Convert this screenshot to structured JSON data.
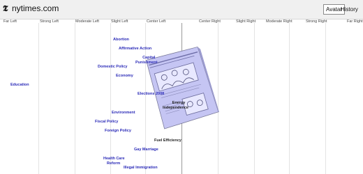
{
  "header": {
    "site_name": "nytimes.com",
    "logo_icon": "nyt-t-logo-icon",
    "avatar_button": "Avatar",
    "history_link": "History"
  },
  "spectrum": {
    "columns": [
      "Far Left",
      "Strong Left",
      "Moderate Left",
      "Slight Left",
      "Center Left",
      "Center Right",
      "Slight Right",
      "Moderate Right",
      "Strong Right",
      "Far Right"
    ]
  },
  "topics": {
    "abortion": "Abortion",
    "affirmative_action": "Affirmative Action",
    "capital_punishment_1": "Capital",
    "capital_punishment_2": "Punishment",
    "domestic_policy": "Domestic Policy",
    "economy": "Economy",
    "education": "Education",
    "elections_2008": "Elections 2008",
    "energy_independence_1": "Energy",
    "energy_independence_2": "Independence",
    "environment": "Environment",
    "fiscal_policy": "Fiscal Policy",
    "foreign_policy": "Foreign Policy",
    "fuel_efficiency": "Fuel Efficiency",
    "gay_marriage": "Gay Marriage",
    "health_care_1": "Health Care",
    "health_care_2": "Reform",
    "illegal_immigration": "Illegal Immigration"
  },
  "colors": {
    "topic_link": "#2b2bb8",
    "magazine_fill": "#c5c5f3",
    "header_bg": "#f0f0f0"
  }
}
